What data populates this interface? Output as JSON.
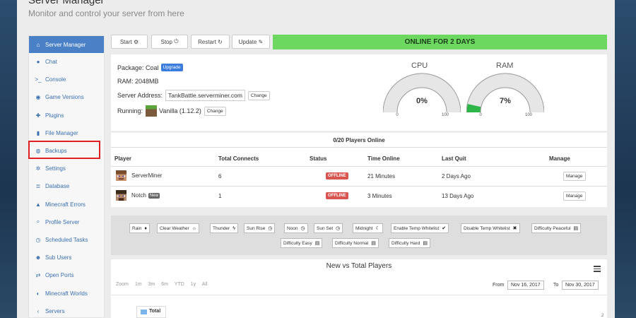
{
  "header": {
    "title": "Server Manager",
    "subtitle": "Monitor and control your server from here"
  },
  "sidebar": {
    "items": [
      {
        "label": "Server Manager",
        "icon": "home-icon",
        "glyph": "⌂"
      },
      {
        "label": "Chat",
        "icon": "chat-icon",
        "glyph": "●"
      },
      {
        "label": "Console",
        "icon": "terminal-icon",
        "glyph": ">_"
      },
      {
        "label": "Game Versions",
        "icon": "globe-icon",
        "glyph": "◉"
      },
      {
        "label": "Plugins",
        "icon": "puzzle-icon",
        "glyph": "✚"
      },
      {
        "label": "File Manager",
        "icon": "file-icon",
        "glyph": "▮"
      },
      {
        "label": "Backups",
        "icon": "backup-icon",
        "glyph": "◍"
      },
      {
        "label": "Settings",
        "icon": "gear-icon",
        "glyph": "✲"
      },
      {
        "label": "Database",
        "icon": "database-icon",
        "glyph": "≣"
      },
      {
        "label": "Minecraft Errors",
        "icon": "warning-icon",
        "glyph": "▲"
      },
      {
        "label": "Profile Server",
        "icon": "search-icon",
        "glyph": "⌕"
      },
      {
        "label": "Scheduled Tasks",
        "icon": "clock-icon",
        "glyph": "◷"
      },
      {
        "label": "Sub Users",
        "icon": "users-icon",
        "glyph": "☻"
      },
      {
        "label": "Open Ports",
        "icon": "plug-icon",
        "glyph": "⇄"
      },
      {
        "label": "Minecraft Worlds",
        "icon": "world-icon",
        "glyph": "◐"
      },
      {
        "label": "Servers",
        "icon": "chevron-left-icon",
        "glyph": "‹"
      }
    ]
  },
  "toolbar": {
    "start_label": "Start",
    "start_glyph": "⚙",
    "stop_label": "Stop",
    "stop_glyph": "⏻",
    "restart_label": "Restart",
    "restart_glyph": "↻",
    "update_label": "Update",
    "update_glyph": "✎"
  },
  "status": {
    "text": "ONLINE FOR 2 DAYS",
    "color": "#6dd860"
  },
  "server_info": {
    "package_label": "Package:",
    "package_value": "Coal",
    "upgrade_label": "Upgrade",
    "ram_label": "RAM:",
    "ram_value": "2048MB",
    "address_label": "Server Address:",
    "address_value": "TankBattle.serverminer.com",
    "change_label": "Change",
    "running_label": "Running:",
    "running_value": "Vanilla (1.12.2)",
    "running_change_label": "Change"
  },
  "gauges": [
    {
      "label": "CPU",
      "value_text": "0%",
      "value": 0,
      "min": "0",
      "max": "100"
    },
    {
      "label": "RAM",
      "value_text": "7%",
      "value": 7,
      "min": "0",
      "max": "100"
    }
  ],
  "players": {
    "title": "0/20 Players Online",
    "headers": [
      "Player",
      "Total Connects",
      "Status",
      "Time Online",
      "Last Quit",
      "Manage"
    ],
    "rows": [
      {
        "name": "ServerMiner",
        "new": "",
        "connects": "6",
        "status": "OFFLINE",
        "time": "21 Minutes",
        "last_quit": "2 Days Ago",
        "manage": "Manage"
      },
      {
        "name": "Notch",
        "new": "New",
        "connects": "1",
        "status": "OFFLINE",
        "time": "3 Minutes",
        "last_quit": "13 Days Ago",
        "manage": "Manage"
      }
    ]
  },
  "commands": [
    {
      "label": "Rain",
      "glyph": "♦"
    },
    {
      "label": "Clear Weather",
      "glyph": "☼"
    },
    {
      "label": "Thunder",
      "glyph": "ϟ"
    },
    {
      "label": "Sun Rise",
      "glyph": "◷"
    },
    {
      "label": "Noon",
      "glyph": "◷"
    },
    {
      "label": "Sun Set",
      "glyph": "◷"
    },
    {
      "label": "Midnight",
      "glyph": "☾"
    },
    {
      "label": "Enable Temp Whitelist",
      "glyph": "✔"
    },
    {
      "label": "Disable Temp Whitelist",
      "glyph": "✖"
    },
    {
      "label": "Difficulty Peaceful",
      "glyph": "▤"
    },
    {
      "label": "Difficulty Easy",
      "glyph": "▤"
    },
    {
      "label": "Difficulty Normal",
      "glyph": "▤"
    },
    {
      "label": "Difficulty Hard",
      "glyph": "▤"
    }
  ],
  "chart": {
    "title": "New vs Total Players",
    "zoom_label": "Zoom",
    "zoom_options": [
      "1m",
      "3m",
      "6m",
      "YTD",
      "1y",
      "All"
    ],
    "from_label": "From",
    "from_value": "Nov 16, 2017",
    "to_label": "To",
    "to_value": "Nov 30, 2017",
    "legend_total": "Total",
    "y_tick_top": "2"
  }
}
